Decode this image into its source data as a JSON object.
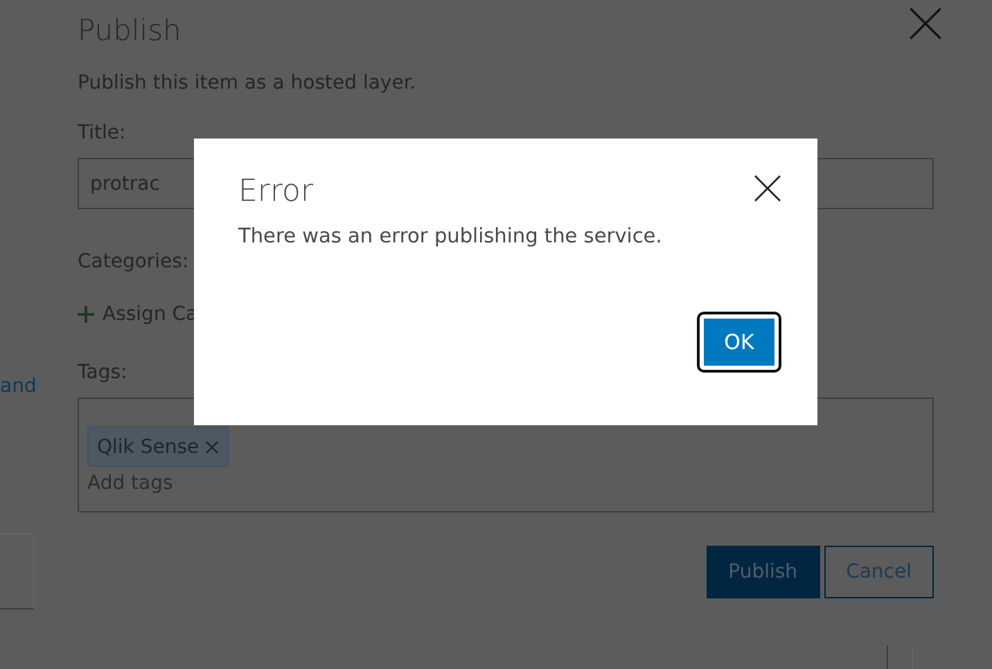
{
  "panel": {
    "title": "Publish",
    "subtitle": "Publish this item as a hosted layer.",
    "title_field": {
      "label": "Title:",
      "value": "protrac"
    },
    "categories": {
      "label": "Categories:",
      "action": "Assign Ca"
    },
    "tags": {
      "label": "Tags:",
      "items": [
        "Qlik Sense"
      ],
      "placeholder": "Add tags"
    },
    "buttons": [
      {
        "label": "Publish",
        "kind": "primary"
      },
      {
        "label": "Cancel",
        "kind": "secondary"
      }
    ]
  },
  "side_link": "and",
  "dialog": {
    "title": "Error",
    "message": "There was an error publishing the service.",
    "button": "OK"
  }
}
